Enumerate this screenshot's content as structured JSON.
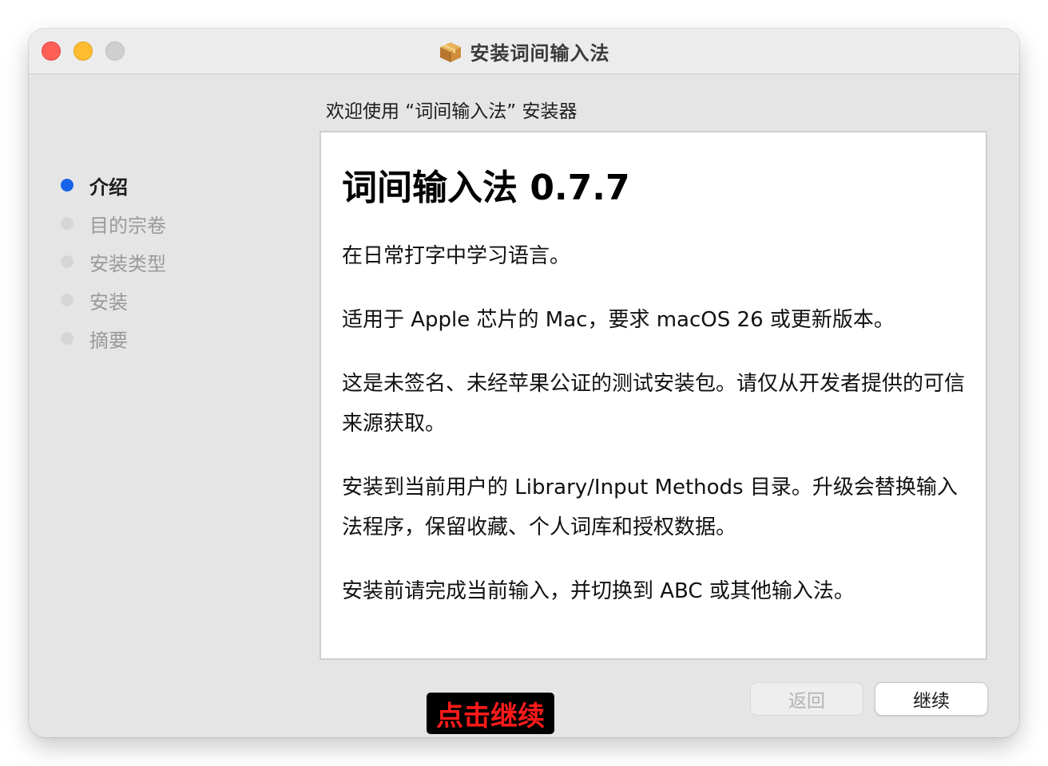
{
  "window": {
    "title": "安装词间输入法",
    "title_icon": "package-icon",
    "traffic_lights": [
      "close",
      "minimize",
      "zoom"
    ]
  },
  "welcome_text": "欢迎使用 “词间输入法” 安装器",
  "sidebar": {
    "steps": [
      {
        "label": "介绍",
        "active": true
      },
      {
        "label": "目的宗卷",
        "active": false
      },
      {
        "label": "安装类型",
        "active": false
      },
      {
        "label": "安装",
        "active": false
      },
      {
        "label": "摘要",
        "active": false
      }
    ]
  },
  "content": {
    "heading": "词间输入法 0.7.7",
    "paragraphs": [
      "在日常打字中学习语言。",
      "适用于 Apple 芯片的 Mac，要求 macOS 26 或更新版本。",
      "这是未签名、未经苹果公证的测试安装包。请仅从开发者提供的可信来源获取。",
      "安装到当前用户的 Library/Input Methods 目录。升级会替换输入法程序，保留收藏、个人词库和授权数据。",
      "安装前请完成当前输入，并切换到 ABC 或其他输入法。"
    ]
  },
  "buttons": {
    "back": "返回",
    "continue": "继续"
  },
  "overlay_hint": "点击继续",
  "colors": {
    "accent": "#1764ea",
    "close": "#fe5f57",
    "minimize": "#febc2e",
    "hint_text": "#ff1a1a"
  }
}
